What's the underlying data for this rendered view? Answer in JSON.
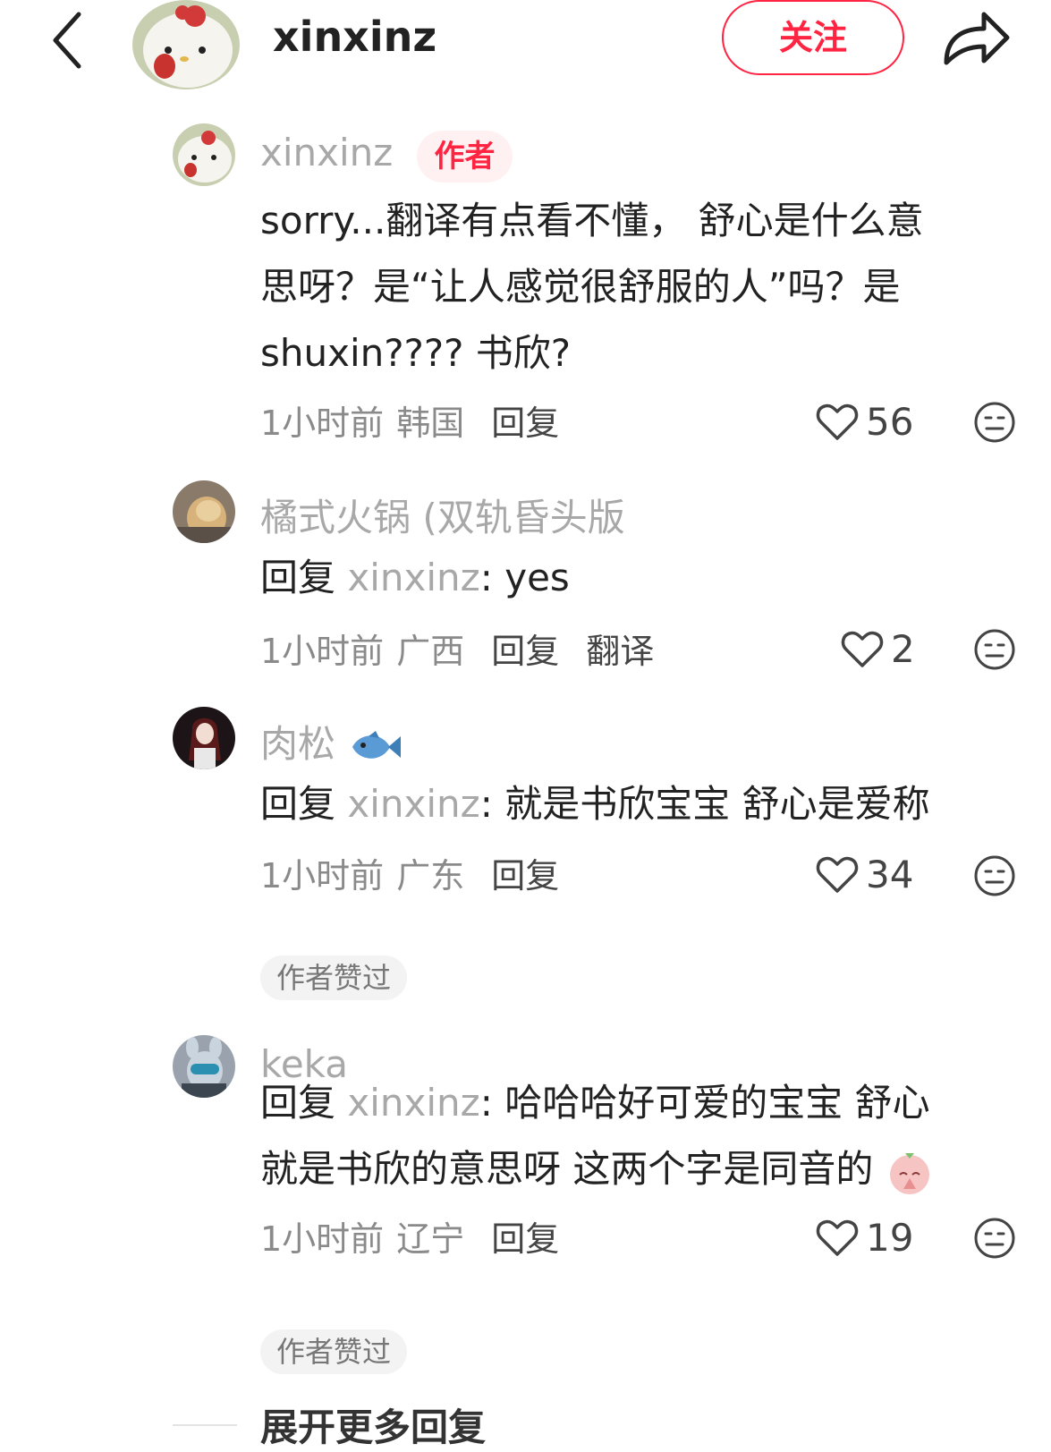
{
  "header": {
    "username": "xinxinz",
    "follow_label": "关注"
  },
  "comments": [
    {
      "author": "xinxinz",
      "badge": "作者",
      "lines": [
        "sorry...翻译有点看不懂， 舒心是什么意",
        "思呀？是“让人感觉很舒服的人”吗？是",
        "shuxin???? 书欣?"
      ],
      "time": "1小时前",
      "location": "韩国",
      "reply_label": "回复",
      "likes": "56"
    },
    {
      "author": "橘式火锅 (双轨昏头版",
      "reply_prefix": "回复",
      "reply_to": "xinxinz",
      "lines": [
        ": yes"
      ],
      "time": "1小时前",
      "location": "广西",
      "reply_label": "回复",
      "translate_label": "翻译",
      "likes": "2"
    },
    {
      "author": "肉松",
      "author_emoji": "fish-emoji",
      "reply_prefix": "回复",
      "reply_to": "xinxinz",
      "lines": [
        ": 就是书欣宝宝 舒心是爱称"
      ],
      "time": "1小时前",
      "location": "广东",
      "reply_label": "回复",
      "likes": "34",
      "liked_tag": "作者赞过"
    },
    {
      "author": "keka",
      "reply_prefix": "回复",
      "reply_to": "xinxinz",
      "lines": [
        ": 哈哈哈好可爱的宝宝 舒心",
        "就是书欣的意思呀 这两个字是同音的"
      ],
      "time": "1小时前",
      "location": "辽宁",
      "reply_label": "回复",
      "likes": "19",
      "liked_tag": "作者赞过"
    }
  ],
  "expand_more": "展开更多回复",
  "colors": {
    "accent": "#ff2442",
    "muted": "#a8a8a8"
  }
}
